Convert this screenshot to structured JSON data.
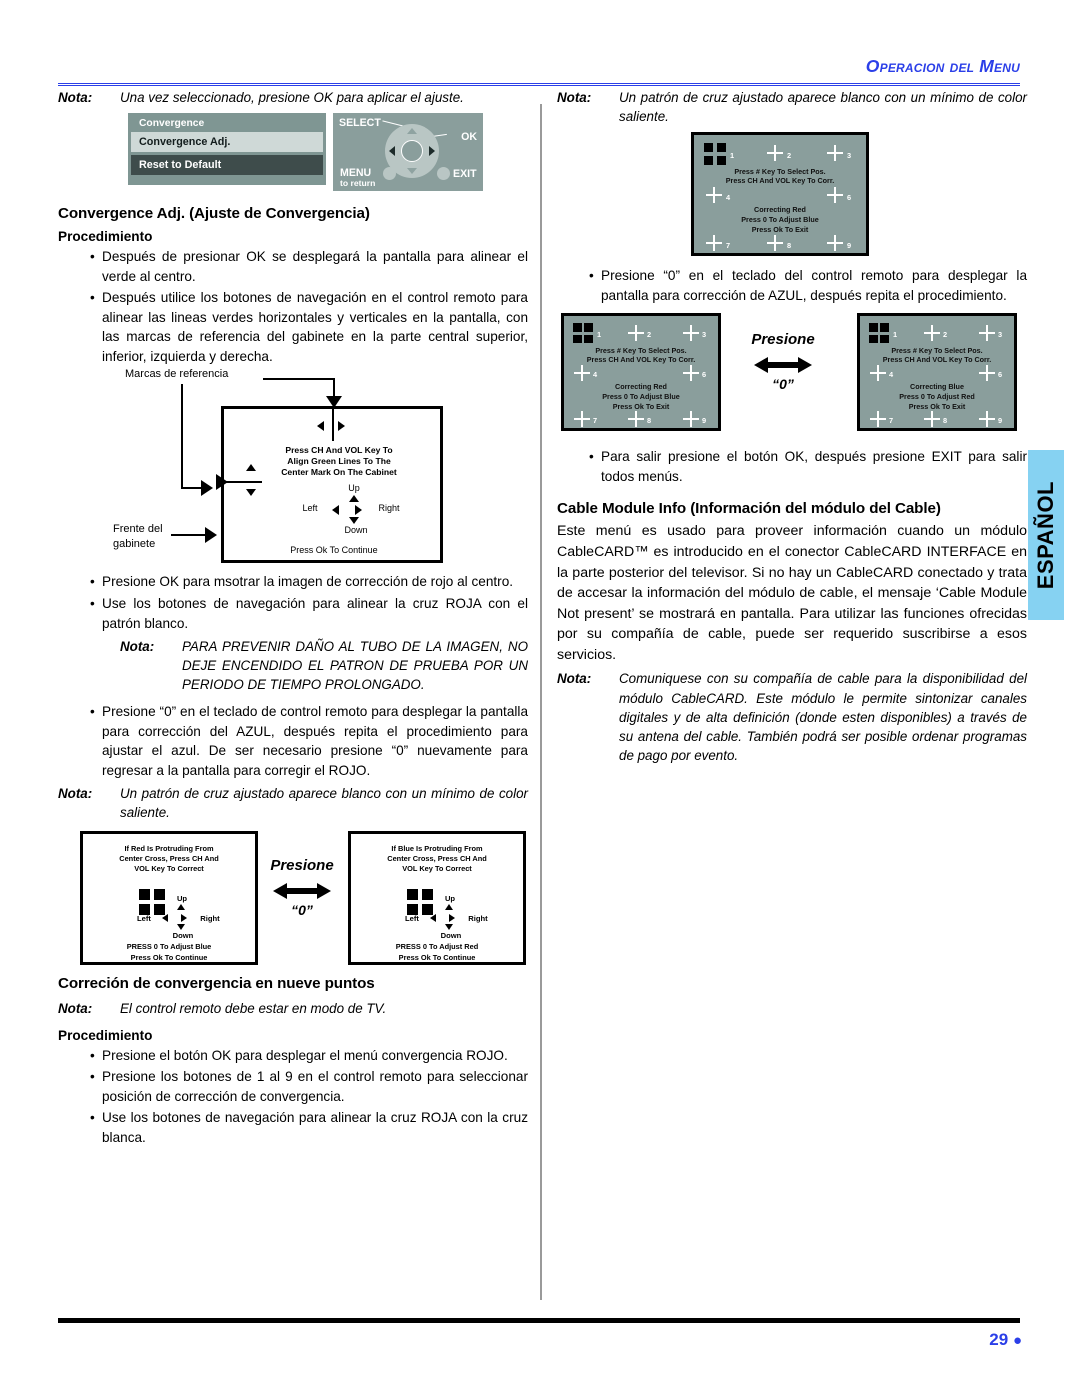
{
  "header": {
    "title": "Operacion del Menu"
  },
  "footer": {
    "page_number": "29",
    "bullet": "●"
  },
  "side_tab": {
    "label": "ESPAÑOL"
  },
  "left": {
    "note_top": {
      "label": "Nota:",
      "text": "Una vez seleccionado, presione OK para aplicar el ajuste."
    },
    "osd": {
      "menu_title": "Convergence",
      "item_selected": "Convergence  Adj.",
      "item_default": "Reset to Default",
      "pad_select": "SELECT",
      "pad_ok": "OK",
      "pad_menu": "MENU",
      "pad_menu_sub": "to return",
      "pad_exit": "EXIT"
    },
    "heading": "Convergence Adj. (Ajuste de Convergencia)",
    "procedure_label": "Procedimiento",
    "bullets_1": [
      "Después de presionar OK se desplegará la pantalla para alinear el verde al centro.",
      "Después utilice los botones de navegación en el control remoto para alinear las lineas verdes horizontales y verticales en la pantalla, con las marcas de referencia del gabinete en la parte central superior, inferior, izquierda y derecha."
    ],
    "green_diagram": {
      "caption_marks": "Marcas de referencia",
      "caption_front_1": "Frente del",
      "caption_front_2": "gabinete",
      "screen_line_1": "Press CH And VOL Key To",
      "screen_line_2": "Align Green Lines To The",
      "screen_line_3": "Center Mark On The Cabinet",
      "up": "Up",
      "down": "Down",
      "left": "Left",
      "right": "Right",
      "footer": "Press Ok To Continue"
    },
    "bullets_2": [
      "Presione OK para msotrar la imagen de corrección de rojo al centro.",
      "Use los botones de navegación para alinear la cruz ROJA con el patrón blanco."
    ],
    "note_caution": {
      "label": "Nota:",
      "text": "PARA PREVENIR DAÑO AL TUBO DE LA IMAGEN, NO DEJE ENCENDIDO EL PATRON DE PRUEBA POR UN PERIODO DE TIEMPO PROLONGADO."
    },
    "bullets_3": [
      "Presione “0” en el teclado de control remoto para desplegar la pantalla para corrección del AZUL, después repita el procedimiento para ajustar el azul. De ser necesario presione “0” nuevamente para regresar a la pantalla para corregir el ROJO."
    ],
    "note_cross": {
      "label": "Nota:",
      "text": "Un patrón de cruz ajustado aparece blanco con un mínimo de color saliente."
    },
    "pair_white": {
      "left_screen": {
        "line1": "If Red Is Protruding From",
        "line2": "Center Cross, Press CH And",
        "line3": "VOL Key To Correct",
        "up": "Up",
        "down": "Down",
        "left": "Left",
        "right": "Right",
        "foot1": "PRESS 0 To Adjust Blue",
        "foot2": "Press Ok To Continue"
      },
      "middle": {
        "press": "Presione",
        "key": "“0”"
      },
      "right_screen": {
        "line1": "If Blue Is Protruding From",
        "line2": "Center Cross, Press CH And",
        "line3": "VOL Key To Correct",
        "up": "Up",
        "down": "Down",
        "left": "Left",
        "right": "Right",
        "foot1": "PRESS 0 To Adjust Red",
        "foot2": "Press Ok To Continue"
      }
    },
    "heading_nine": "Correción de convergencia en nueve puntos",
    "note_nine": {
      "label": "Nota:",
      "text": "El control remoto debe estar en modo de TV."
    },
    "procedure_label_2": "Procedimiento",
    "bullets_4": [
      "Presione el botón OK para desplegar el menú convergencia ROJO.",
      "Presione los botones de 1 al 9 en el control remoto para seleccionar posición de corrección de convergencia.",
      "Use los botones de navegación para alinear la cruz ROJA con la cruz blanca."
    ]
  },
  "right": {
    "note_top": {
      "label": "Nota:",
      "text": "Un patrón de cruz ajustado aparece blanco con un mínimo de color saliente."
    },
    "teal_single": {
      "numbers": [
        "1",
        "2",
        "3",
        "4",
        "6",
        "7",
        "8",
        "9"
      ],
      "msg_top_1": "Press # Key To Select Pos.",
      "msg_top_2": "Press CH And VOL Key To Corr.",
      "msg_mid_1": "Correcting Red",
      "msg_mid_2": "Press 0 To Adjust Blue",
      "msg_mid_3": "Press Ok To Exit"
    },
    "bullets_1": [
      "Presione “0” en el teclado del control remoto para desplegar la pantalla para corrección de AZUL, después repita el procedimiento."
    ],
    "pair_teal": {
      "left_screen": {
        "msg_top_1": "Press # Key To Select Pos.",
        "msg_top_2": "Press CH And VOL Key To Corr.",
        "msg_mid_1": "Correcting Red",
        "msg_mid_2": "Press 0 To Adjust Blue",
        "msg_mid_3": "Press Ok To Exit"
      },
      "middle": {
        "press": "Presione",
        "key": "“0”"
      },
      "right_screen": {
        "msg_top_1": "Press # Key To Select Pos.",
        "msg_top_2": "Press CH And VOL Key To Corr.",
        "msg_mid_1": "Correcting Blue",
        "msg_mid_2": "Press 0 To Adjust Red",
        "msg_mid_3": "Press Ok To Exit"
      }
    },
    "bullets_2": [
      "Para salir presione el botón OK, después presione EXIT para salir todos menús."
    ],
    "heading_cable": "Cable Module Info (Información del módulo del Cable)",
    "paragraph_cable": "Este menú es usado para proveer información cuando un módulo CableCARD™ es introducido en el conector CableCARD INTERFACE en la parte posterior del televisor. Si no hay un CableCARD conectado y trata de accesar la información del módulo de cable, el mensaje ‘Cable Module Not present’ se mostrará en pantalla. Para utilizar las funciones ofrecidas por su compañía de cable, puede ser requerido suscribirse a esos servicios.",
    "note_cable": {
      "label": "Nota:",
      "text": "Comuniquese con su compañía de cable para la disponibilidad del módulo CableCARD. Este módulo le permite sintonizar canales digitales y de alta definición (donde esten disponibles) a través de su antena del cable. También podrá ser posible ordenar programas de pago por evento."
    }
  },
  "colors": {
    "accent_blue": "#2b3fe8",
    "tab_blue": "#86d2f2",
    "osd_teal": "#7f9693",
    "osd_pad": "#8a9e9c",
    "osd_selected": "#cfd9d7",
    "osd_dark": "#3e4c4b"
  }
}
